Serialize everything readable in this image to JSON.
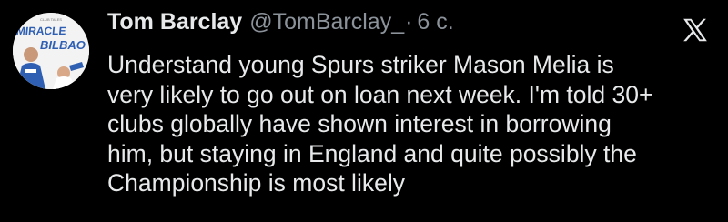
{
  "tweet": {
    "author_name": "Tom Barclay",
    "handle": "@TomBarclay_",
    "separator": "·",
    "time": "6 с.",
    "text_lines": [
      "Understand young Spurs striker Mason Melia is",
      "very likely to go out on loan next week. I'm told 30+",
      "clubs globally have shown interest in borrowing",
      "him, but staying in England and quite possibly the",
      "Championship is most likely"
    ]
  },
  "avatar": {
    "line1": "MIRACLE",
    "line2": "BILBAO",
    "top_text": "CLUB TALES"
  },
  "icons": {
    "logo": "x-logo-icon"
  },
  "colors": {
    "background": "#000000",
    "primary_text": "#e7e9ea",
    "secondary_text": "#8b9299",
    "avatar_blue": "#2f5fb3"
  }
}
